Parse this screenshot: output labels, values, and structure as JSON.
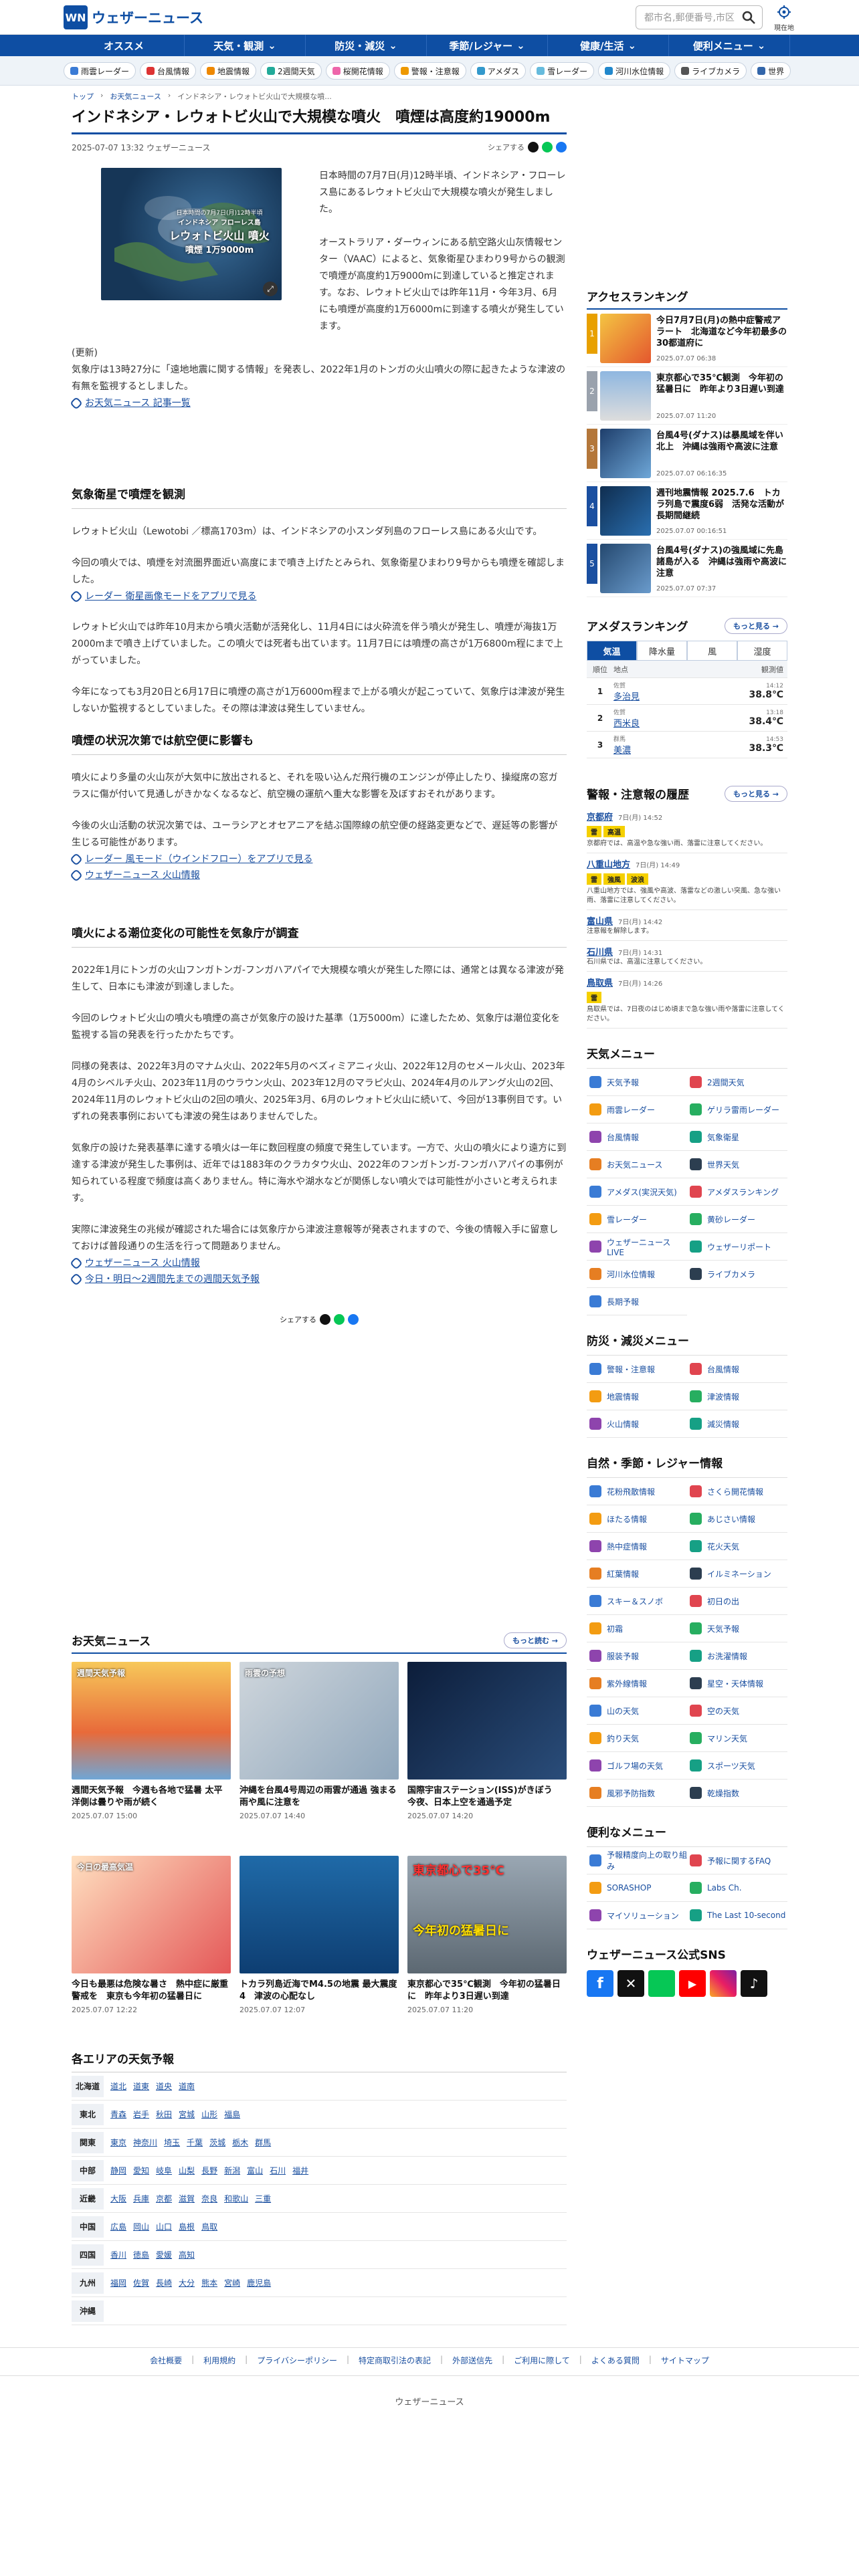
{
  "header": {
    "logo_mark": "WN",
    "logo_text": "ウェザーニュース",
    "search_placeholder": "都市名,郵便番号,市区",
    "geo_label": "現在地"
  },
  "gnav": [
    "オススメ",
    "天気・観測",
    "防災・減災",
    "季節/レジャー",
    "健康/生活",
    "便利メニュー"
  ],
  "subnav": [
    {
      "label": "雨雲レーダー",
      "color": "#3a7bd5"
    },
    {
      "label": "台風情報",
      "color": "#d33"
    },
    {
      "label": "地震情報",
      "color": "#e80"
    },
    {
      "label": "2週間天気",
      "color": "#2a9"
    },
    {
      "label": "桜開花情報",
      "color": "#e6a"
    },
    {
      "label": "警報・注意報",
      "color": "#e90"
    },
    {
      "label": "アメダス",
      "color": "#39c"
    },
    {
      "label": "雪レーダー",
      "color": "#6bd"
    },
    {
      "label": "河川水位情報",
      "color": "#28c"
    },
    {
      "label": "ライブカメラ",
      "color": "#555"
    },
    {
      "label": "世界",
      "color": "#36a"
    }
  ],
  "breadcrumb": [
    "トップ",
    "お天気ニュース",
    "インドネシア・レウォトビ火山で大規模な噴..."
  ],
  "article": {
    "title": "インドネシア・レウォトビ火山で大規模な噴火　噴煙は高度約19000m",
    "date": "2025-07-07 13:32 ウェザーニュース",
    "share_label": "シェアする",
    "image_caption_lines": [
      "日本時間の7月7日(月)12時半頃",
      "インドネシア フローレス島",
      "レウォトビ火山 噴火",
      "噴煙 1万9000m"
    ],
    "lead": "日本時間の7月7日(月)12時半頃、インドネシア・フローレス島にあるレウォトビ火山で大規模な噴火が発生しました。",
    "p2": "オーストラリア・ダーウィンにある航空路火山灰情報センター（VAAC）によると、気象衛星ひまわり9号からの観測で噴煙が高度約1万9000mに到達していると推定されます。なお、レウォトビ火山では昨年11月・今年3月、6月にも噴煙が高度約1万6000mに到達する噴火が発生しています。",
    "p3": "(更新)\n気象庁は13時27分に「遠地地震に関する情報」を発表し、2022年1月のトンガの火山噴火の際に起きたような津波の有無を監視するとしました。",
    "link1": "お天気ニュース 記事一覧",
    "h2a": "気象衛星で噴煙を観測",
    "s1p1": "レウォトビ火山（Lewotobi ／標高1703m）は、インドネシアの小スンダ列島のフローレス島にある火山です。",
    "s1p2": "今回の噴火では、噴煙を対流圏界面近い高度にまで噴き上げたとみられ、気象衛星ひまわり9号からも噴煙を確認しました。",
    "link2": "レーダー 衛星画像モードをアプリで見る",
    "s1p3": "レウォトビ火山では昨年10月末から噴火活動が活発化し、11月4日には火砕流を伴う噴火が発生し、噴煙が海抜1万2000mまで噴き上げていました。この噴火では死者も出ています。11月7日には噴煙の高さが1万6800m程にまで上がっていました。",
    "s1p4": "今年になっても3月20日と6月17日に噴煙の高さが1万6000m程まで上がる噴火が起こっていて、気象庁は津波が発生しないか監視するとしていました。その際は津波は発生していません。",
    "h2b": "噴煙の状況次第では航空便に影響も",
    "s2p1": "噴火により多量の火山灰が大気中に放出されると、それを吸い込んだ飛行機のエンジンが停止したり、操縦席の窓ガラスに傷が付いて見通しがきかなくなるなど、航空機の運航へ重大な影響を及ぼすおそれがあります。",
    "s2p2": "今後の火山活動の状況次第では、ユーラシアとオセアニアを結ぶ国際線の航空便の経路変更などで、遅延等の影響が生じる可能性があります。",
    "link3": "レーダー 風モード（ウインドフロー）をアプリで見る",
    "link4": "ウェザーニュース 火山情報",
    "h2c": "噴火による潮位変化の可能性を気象庁が調査",
    "s3p1": "2022年1月にトンガの火山フンガトンガ-フンガハアパイで大規模な噴火が発生した際には、通常とは異なる津波が発生して、日本にも津波が到達しました。",
    "s3p2": "今回のレウォトビ火山の噴火も噴煙の高さが気象庁の設けた基準（1万5000m）に達したため、気象庁は潮位変化を監視する旨の発表を行ったかたちです。",
    "s3p3": "同様の発表は、2022年3月のマナム火山、2022年5月のベズィミアニィ火山、2022年12月のセメール火山、2023年4月のシベルチ火山、2023年11月のウラウン火山、2023年12月のマラピ火山、2024年4月のルアング火山の2回、2024年11月のレウォトビ火山の2回の噴火、2025年3月、6月のレウォトビ火山に続いて、今回が13事例目です。いずれの発表事例においても津波の発生はありませんでした。",
    "s3p4": "気象庁の設けた発表基準に達する噴火は一年に数回程度の頻度で発生しています。一方で、火山の噴火により遠方に到達する津波が発生した事例は、近年では1883年のクラカタウ火山、2022年のフンガトンガ-フンガハアパイの事例が知られている程度で頻度は高くありません。特に海水や湖水などが関係しない噴火では可能性が小さいと考えられます。",
    "s3p5": "実際に津波発生の兆候が確認された場合には気象庁から津波注意報等が発表されますので、今後の情報入手に留意しておけば普段通りの生活を行って問題ありません。",
    "link5": "ウェザーニュース 火山情報",
    "link6": "今日・明日〜2週間先までの週間天気予報",
    "share2": "シェアする"
  },
  "access_ranking": {
    "title": "アクセスランキング",
    "items": [
      {
        "rank": "1",
        "title": "今日7月7日(月)の熱中症警戒アラート　北海道など今年初最多の30都道府に",
        "date": "2025.07.07 06:38",
        "color": "#e8a000"
      },
      {
        "rank": "2",
        "title": "東京都心で35℃観測　今年初の猛暑日に　昨年より3日遅い到達",
        "date": "2025.07.07 11:20",
        "color": "#9aa2ad"
      },
      {
        "rank": "3",
        "title": "台風4号(ダナス)は暴風域を伴い北上　沖縄は強雨や高波に注意",
        "date": "2025.07.07 06:16:35",
        "color": "#b4773a"
      },
      {
        "rank": "4",
        "title": "週刊地震情報 2025.7.6　トカラ列島で震度6弱　活発な活動が長期間継続",
        "date": "2025.07.07 00:16:51",
        "color": "#1a4fa0"
      },
      {
        "rank": "5",
        "title": "台風4号(ダナス)の強風域に先島諸島が入る　沖縄は強雨や高波に注意",
        "date": "2025.07.07 07:37",
        "color": "#1a4fa0"
      }
    ]
  },
  "amedas": {
    "title": "アメダスランキング",
    "more": "もっと見る",
    "tabs": [
      "気温",
      "降水量",
      "風",
      "湿度"
    ],
    "head": [
      "順位",
      "地点",
      "観測値"
    ],
    "rows": [
      {
        "rank": "1",
        "pref": "佐賀",
        "place": "多治見",
        "time": "14:12",
        "value": "38.8℃"
      },
      {
        "rank": "2",
        "pref": "佐賀",
        "place": "西米良",
        "time": "13:18",
        "value": "38.4℃"
      },
      {
        "rank": "3",
        "pref": "群馬",
        "place": "美濃",
        "time": "14:53",
        "value": "38.3℃"
      }
    ]
  },
  "warnings": {
    "title": "警報・注意報の履歴",
    "more": "もっと見る",
    "items": [
      {
        "place": "京都府",
        "time": "7日(月) 14:52",
        "badges": [
          "雷",
          "高温"
        ],
        "text": "京都府では、高温や急な強い雨、落雷に注意してください。"
      },
      {
        "place": "八重山地方",
        "time": "7日(月) 14:49",
        "badges": [
          "雷",
          "強風",
          "波浪"
        ],
        "text": "八重山地方では、強風や高波、落雷などの激しい突風、急な強い雨、落雷に注意してください。"
      },
      {
        "place": "富山県",
        "time": "7日(月) 14:42",
        "badges": [],
        "text": "注意報を解除します。"
      },
      {
        "place": "石川県",
        "time": "7日(月) 14:31",
        "badges": [],
        "text": "石川県では、高温に注意してください。"
      },
      {
        "place": "鳥取県",
        "time": "7日(月) 14:26",
        "badges": [
          "雷"
        ],
        "text": "鳥取県では、7日夜のはじめ頃まで急な強い雨や落雷に注意してください。"
      }
    ]
  },
  "weather_menu": {
    "title": "天気メニュー",
    "items": [
      "天気予報",
      "2週間天気",
      "雨雲レーダー",
      "ゲリラ雷雨レーダー",
      "台風情報",
      "気象衛星",
      "お天気ニュース",
      "世界天気",
      "アメダス(実況天気)",
      "アメダスランキング",
      "雪レーダー",
      "黄砂レーダー",
      "ウェザーニュースLIVE",
      "ウェザーリポート",
      "河川水位情報",
      "ライブカメラ",
      "長期予報"
    ]
  },
  "disaster_menu": {
    "title": "防災・減災メニュー",
    "items": [
      "警報・注意報",
      "台風情報",
      "地震情報",
      "津波情報",
      "火山情報",
      "減災情報"
    ]
  },
  "season_menu": {
    "title": "自然・季節・レジャー情報",
    "items": [
      "花粉飛散情報",
      "さくら開花情報",
      "ほたる情報",
      "あじさい情報",
      "熱中症情報",
      "花火天気",
      "紅葉情報",
      "イルミネーション",
      "スキー＆スノボ",
      "初日の出",
      "初霜",
      "天気予報",
      "服装予報",
      "お洗濯情報",
      "紫外線情報",
      "星空・天体情報",
      "山の天気",
      "空の天気",
      "釣り天気",
      "マリン天気",
      "ゴルフ場の天気",
      "スポーツ天気",
      "風邪予防指数",
      "乾燥指数"
    ]
  },
  "convenient_menu": {
    "title": "便利なメニュー",
    "items": [
      "予報精度向上の取り組み",
      "予報に関するFAQ",
      "SORASHOP",
      "Labs Ch.",
      "マイソリューション",
      "The Last 10-second"
    ]
  },
  "sns": {
    "title": "ウェザーニュース公式SNS"
  },
  "news": {
    "title": "お天気ニュース",
    "more": "もっと読む",
    "items": [
      {
        "title": "週間天気予報　今週も各地で猛暑 太平洋側は曇りや雨が続く",
        "date": "2025.07.07 15:00"
      },
      {
        "title": "沖縄を台風4号周辺の雨雲が通過 強まる雨や風に注意を",
        "date": "2025.07.07 14:40"
      },
      {
        "title": "国際宇宙ステーション(ISS)がきぼう　今夜、日本上空を通過予定",
        "date": "2025.07.07 14:20"
      },
      {
        "title": "今日も最悪は危険な暑さ　熱中症に厳重警戒を　東京も今年初の猛暑日に",
        "date": "2025.07.07 12:22"
      },
      {
        "title": "トカラ列島近海でM4.5の地震 最大震度4　津波の心配なし",
        "date": "2025.07.07 12:07"
      },
      {
        "title": "東京都心で35℃観測　今年初の猛暑日に　昨年より3日遅い到達",
        "date": "2025.07.07 11:20"
      }
    ],
    "thumb_texts": [
      "週間天気予報",
      "雨雲の予想",
      "今日の最高気温",
      "東京都心で35℃",
      "今年初の猛暑日に"
    ]
  },
  "areas": {
    "title": "各エリアの天気予報",
    "rows": [
      {
        "name": "北海道",
        "links": [
          "道北",
          "道東",
          "道央",
          "道南"
        ]
      },
      {
        "name": "東北",
        "links": [
          "青森",
          "岩手",
          "秋田",
          "宮城",
          "山形",
          "福島"
        ]
      },
      {
        "name": "関東",
        "links": [
          "東京",
          "神奈川",
          "埼玉",
          "千葉",
          "茨城",
          "栃木",
          "群馬"
        ]
      },
      {
        "name": "中部",
        "links": [
          "静岡",
          "愛知",
          "岐阜",
          "山梨",
          "長野",
          "新潟",
          "富山",
          "石川",
          "福井"
        ]
      },
      {
        "name": "近畿",
        "links": [
          "大阪",
          "兵庫",
          "京都",
          "滋賀",
          "奈良",
          "和歌山",
          "三重"
        ]
      },
      {
        "name": "中国",
        "links": [
          "広島",
          "岡山",
          "山口",
          "島根",
          "鳥取"
        ]
      },
      {
        "name": "四国",
        "links": [
          "香川",
          "徳島",
          "愛媛",
          "高知"
        ]
      },
      {
        "name": "九州",
        "links": [
          "福岡",
          "佐賀",
          "長崎",
          "大分",
          "熊本",
          "宮崎",
          "鹿児島"
        ]
      },
      {
        "name": "沖縄",
        "links": []
      }
    ]
  },
  "footer": {
    "links": [
      "会社概要",
      "利用規約",
      "プライバシーポリシー",
      "特定商取引法の表記",
      "外部送信先",
      "ご利用に際して",
      "よくある質問",
      "サイトマップ"
    ],
    "copyright": "ウェザーニュース"
  }
}
